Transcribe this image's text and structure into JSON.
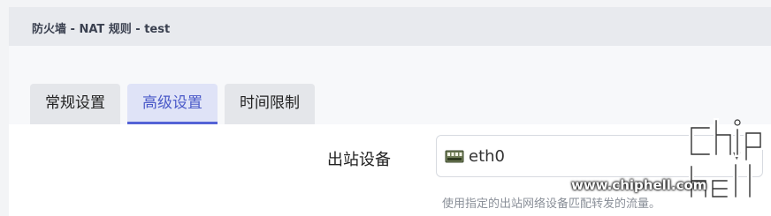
{
  "header": {
    "title": "防火墙 - NAT 规则 - test"
  },
  "tabs": [
    {
      "label": "常规设置",
      "active": false
    },
    {
      "label": "高级设置",
      "active": true
    },
    {
      "label": "时间限制",
      "active": false
    }
  ],
  "form": {
    "egress_device": {
      "label": "出站设备",
      "value": "eth0",
      "icon": "network-port-icon",
      "help": "使用指定的出站网络设备匹配转发的流量。"
    }
  },
  "watermark": {
    "url": "www.chiphell.com",
    "logo_text": "chiphell"
  },
  "colors": {
    "accent": "#5463d6",
    "active_tab_bg": "#dfe3f7"
  }
}
